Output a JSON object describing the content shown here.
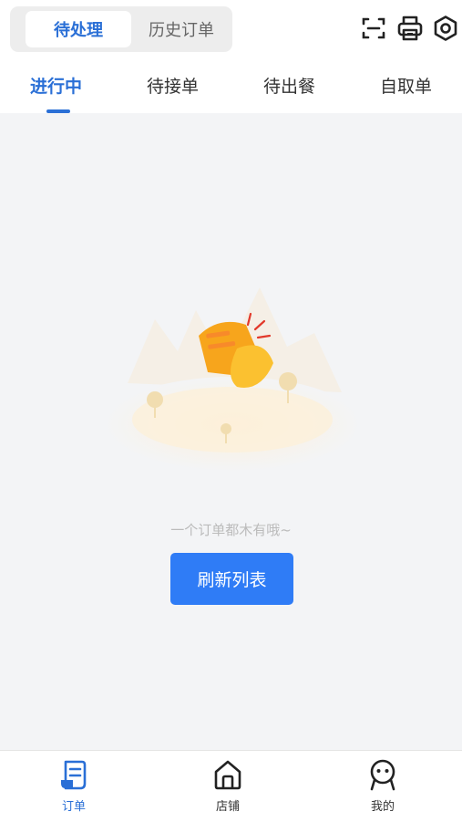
{
  "header": {
    "segment": {
      "active_label": "待处理",
      "inactive_label": "历史订单"
    },
    "icons": [
      "scan-icon",
      "printer-icon",
      "settings-icon"
    ]
  },
  "tabs": [
    {
      "label": "进行中",
      "active": true
    },
    {
      "label": "待接单",
      "active": false
    },
    {
      "label": "待出餐",
      "active": false
    },
    {
      "label": "自取单",
      "active": false
    }
  ],
  "empty_state": {
    "message": "一个订单都木有哦~",
    "refresh_label": "刷新列表"
  },
  "bottom_nav": [
    {
      "label": "订单",
      "icon": "order-icon",
      "active": true
    },
    {
      "label": "店铺",
      "icon": "store-icon",
      "active": false
    },
    {
      "label": "我的",
      "icon": "profile-icon",
      "active": false
    }
  ],
  "colors": {
    "accent": "#2a6fd6",
    "button": "#2f7cf6",
    "illustration_orange": "#f7a51c"
  }
}
